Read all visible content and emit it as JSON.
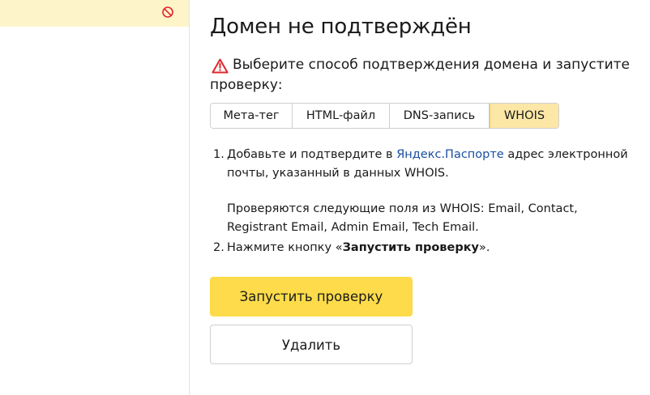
{
  "sidebar": {
    "selected_item": {
      "status_icon": "block-icon"
    }
  },
  "main": {
    "title": "Домен не подтверждён",
    "warning": {
      "icon": "warning-triangle-icon",
      "line1": "Выберите способ подтверждения домена и запустите",
      "line2": "проверку:"
    },
    "tabs": [
      {
        "label": "Мета-тег",
        "active": false
      },
      {
        "label": "HTML-файл",
        "active": false
      },
      {
        "label": "DNS-запись",
        "active": false
      },
      {
        "label": "WHOIS",
        "active": true
      }
    ],
    "steps": {
      "step1": {
        "num": "1.",
        "line1_before": "Добавьте и подтвердите в ",
        "link_yandex": "Яндекс",
        "link_dot": ".",
        "link_passport": "Паспорте",
        "line1_after": " адрес электронной",
        "line2": "почты, указанный в данных WHOIS.",
        "note_line1": "Проверяются следующие поля из WHOIS: Email, Contact,",
        "note_line2": "Registrant Email, Admin Email, Tech Email."
      },
      "step2": {
        "num": "2.",
        "before": "Нажмите кнопку «",
        "bold": "Запустить проверку",
        "after": "»."
      }
    },
    "buttons": {
      "run_check": "Запустить проверку",
      "delete": "Удалить"
    }
  },
  "colors": {
    "accent_yellow": "#fddb4a",
    "active_tab": "#fde7a7",
    "selected_sidebar": "#fdf4c9",
    "warning_red": "#e0262d",
    "link": "#1a4fa0"
  }
}
